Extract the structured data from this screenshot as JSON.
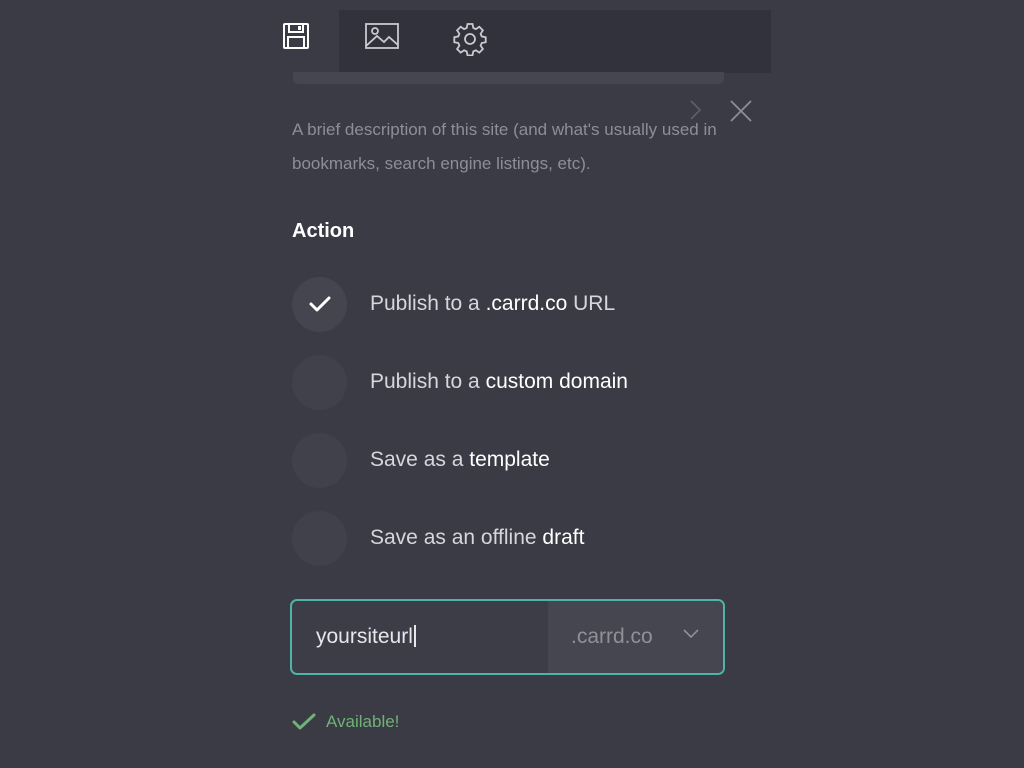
{
  "toolbar": {
    "tabs": [
      {
        "icon": "save-icon",
        "active": true
      },
      {
        "icon": "image-icon",
        "active": false
      },
      {
        "icon": "gear-icon",
        "active": false
      }
    ]
  },
  "description": "A brief description of this site (and what's usually used in bookmarks, search engine listings, etc).",
  "action": {
    "heading": "Action",
    "options": [
      {
        "prefix": "Publish to a ",
        "emphasis": ".carrd.co",
        "suffix": " URL",
        "checked": true
      },
      {
        "prefix": "Publish to a ",
        "emphasis": "custom domain",
        "suffix": "",
        "checked": false
      },
      {
        "prefix": "Save as a ",
        "emphasis": "template",
        "suffix": "",
        "checked": false
      },
      {
        "prefix": "Save as an offline ",
        "emphasis": "draft",
        "suffix": "",
        "checked": false
      }
    ]
  },
  "url": {
    "value": "yoursiteurl",
    "domain": ".carrd.co"
  },
  "status": {
    "text": "Available!",
    "color": "#6fb177"
  },
  "colors": {
    "background": "#3a3b45",
    "accent": "#4fb3a8",
    "success": "#6fb177"
  }
}
